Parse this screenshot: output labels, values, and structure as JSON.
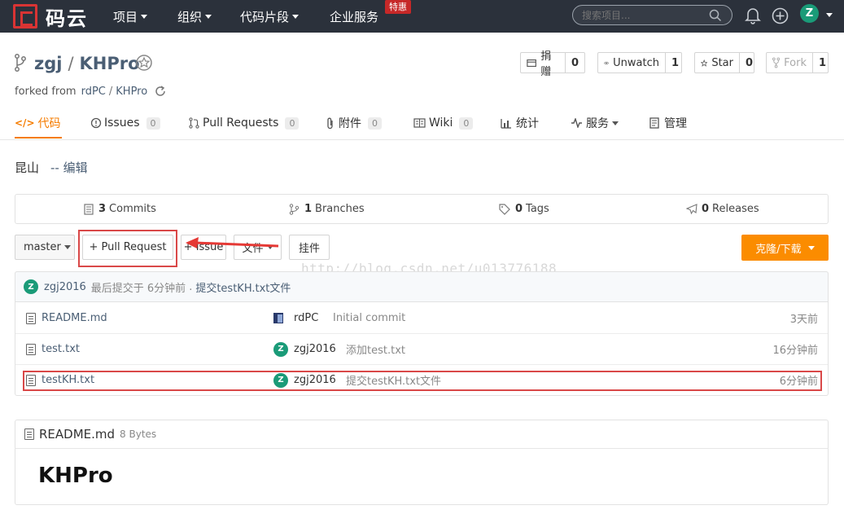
{
  "nav": {
    "logo_text": "码云",
    "items": [
      {
        "label": "项目"
      },
      {
        "label": "组织"
      },
      {
        "label": "代码片段"
      },
      {
        "label": "企业服务"
      }
    ],
    "special_badge": "特惠",
    "search_placeholder": "搜索项目...",
    "user_initial": "Z"
  },
  "repo": {
    "owner": "zgj",
    "separator": "/",
    "name": "KHPro",
    "forked_prefix": "forked from",
    "forked_owner": "rdPC",
    "forked_sep": "/",
    "forked_repo": "KHPro",
    "description": "昆山",
    "edit_label": "-- 编辑"
  },
  "actions": {
    "donate": {
      "label": "捐赠",
      "count": "0"
    },
    "watch": {
      "label": "Unwatch",
      "count": "1"
    },
    "star": {
      "label": "Star",
      "count": "0"
    },
    "fork": {
      "label": "Fork",
      "count": "1"
    }
  },
  "tabs": [
    {
      "label": "代码"
    },
    {
      "label": "Issues",
      "count": "0"
    },
    {
      "label": "Pull Requests",
      "count": "0"
    },
    {
      "label": "附件",
      "count": "0"
    },
    {
      "label": "Wiki",
      "count": "0"
    },
    {
      "label": "统计"
    },
    {
      "label": "服务"
    },
    {
      "label": "管理"
    }
  ],
  "stats": {
    "commits": {
      "count": "3",
      "label": "Commits"
    },
    "branches": {
      "count": "1",
      "label": "Branches"
    },
    "tags": {
      "count": "0",
      "label": "Tags"
    },
    "releases": {
      "count": "0",
      "label": "Releases"
    }
  },
  "toolbar": {
    "branch": "master",
    "pull_request": "+ Pull Request",
    "issue": "+ Issue",
    "file": "文件",
    "widget": "挂件",
    "clone": "克隆/下载"
  },
  "watermark": "http://blog.csdn.net/u013776188",
  "last_commit": {
    "avatar": "Z",
    "author": "zgj2016",
    "text": "最后提交于 6分钟前",
    "dot": ".",
    "message": "提交testKH.txt文件"
  },
  "files": [
    {
      "name": "README.md",
      "author": "rdPC",
      "message": "Initial commit",
      "time": "3天前",
      "avatar": ""
    },
    {
      "name": "test.txt",
      "author": "zgj2016",
      "message": "添加test.txt",
      "time": "16分钟前",
      "avatar": "Z"
    },
    {
      "name": "testKH.txt",
      "author": "zgj2016",
      "message": "提交testKH.txt文件",
      "time": "6分钟前",
      "avatar": "Z"
    }
  ],
  "readme": {
    "filename": "README.md",
    "size": "8 Bytes",
    "heading": "KHPro"
  },
  "colors": {
    "nav_bg": "#2b313b",
    "accent": "#fb8c00",
    "annotation_red": "#d94848",
    "avatar_green": "#1a9b78"
  }
}
